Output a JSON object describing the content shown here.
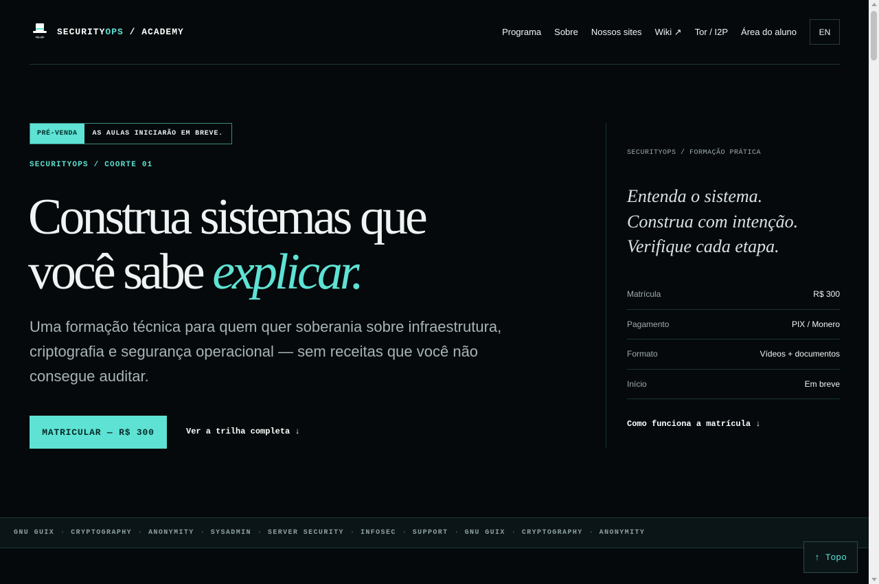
{
  "header": {
    "brand": {
      "part1": "SECURITY",
      "part2": "OPS",
      "part3": " / ACADEMY",
      "logo_icon": "top-hat-mustache-icon"
    },
    "nav": [
      "Programa",
      "Sobre",
      "Nossos sites",
      "Wiki ↗",
      "Tor / I2P",
      "Área do aluno"
    ],
    "lang": "EN"
  },
  "hero": {
    "badge_tag": "PRÉ-VENDA",
    "badge_text": "AS AULAS INICIARÃO EM BREVE.",
    "eyebrow": "SECURITYOPS / COORTE 01",
    "headline_line1": "Construa sistemas que",
    "headline_line2_plain": "você sabe ",
    "headline_line2_em": "explicar.",
    "lede": "Uma formação técnica para quem quer soberania sobre infraestrutura, criptografia e segurança operacional — sem receitas que você não consegue auditar.",
    "cta_primary": "MATRICULAR — R$ 300",
    "cta_secondary": "Ver a trilha completa ↓"
  },
  "side": {
    "eyebrow": "SECURITYOPS / FORMAÇÃO PRÁTICA",
    "quote": [
      "Entenda o sistema.",
      "Construa com intenção.",
      "Verifique cada etapa."
    ],
    "facts": [
      {
        "label": "Matrícula",
        "value": "R$ 300"
      },
      {
        "label": "Pagamento",
        "value": "PIX / Monero"
      },
      {
        "label": "Formato",
        "value": "Vídeos + documentos"
      },
      {
        "label": "Início",
        "value": "Em breve"
      }
    ],
    "link": "Como funciona a matrícula ↓"
  },
  "ticker": [
    "GNU GUIX",
    "CRYPTOGRAPHY",
    "ANONYMITY",
    "SYSADMIN",
    "SERVER SECURITY",
    "INFOSEC",
    "SUPPORT",
    "GNU GUIX",
    "CRYPTOGRAPHY",
    "ANONYMITY"
  ],
  "top_button": "↑ Topo",
  "colors": {
    "background": "#05090b",
    "accent": "#5ee2d4",
    "border": "#1c3633"
  }
}
